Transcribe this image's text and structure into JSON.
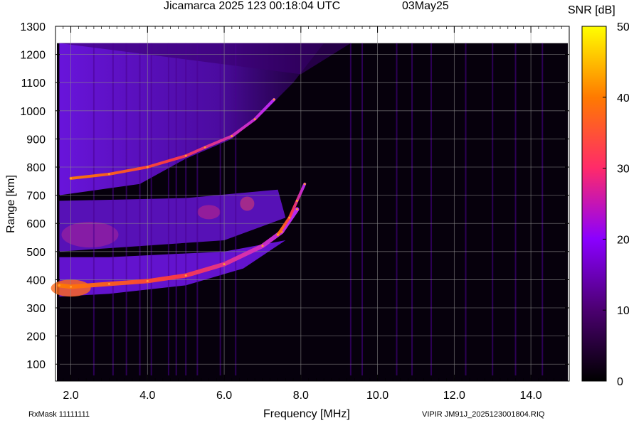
{
  "header": {
    "title": "Jicamarca 2025 123 00:18:04 UTC",
    "date": "03May25"
  },
  "colorbar": {
    "label": "SNR [dB]",
    "ticks": [
      0,
      10,
      20,
      30,
      40,
      50
    ]
  },
  "footer": {
    "rxmask": "RxMask 11111111",
    "filename": "VIPIR  JM91J_2025123001804.RIQ"
  },
  "chart_data": {
    "type": "heatmap",
    "xlabel": "Frequency [MHz]",
    "ylabel": "Range [km]",
    "xlim": [
      1.6,
      15.0
    ],
    "ylim": [
      40,
      1300
    ],
    "xticks": [
      "2.0",
      "4.0",
      "6.0",
      "8.0",
      "10.0",
      "12.0",
      "14.0"
    ],
    "yticks": [
      "100",
      "200",
      "300",
      "400",
      "500",
      "600",
      "700",
      "800",
      "900",
      "1000",
      "1100",
      "1200",
      "1300"
    ],
    "grid": true,
    "colorscale": [
      "#000000",
      "#4b0070",
      "#8a00ff",
      "#ff2a6a",
      "#ff7a00",
      "#ffff00"
    ],
    "zlim": [
      0,
      50
    ],
    "traces": [
      {
        "name": "",
        "x": [
          1.7,
          2.0,
          3.0,
          4.0,
          5.0,
          6.0,
          7.0,
          7.5,
          7.9
        ],
        "y": [
          380,
          375,
          385,
          395,
          415,
          455,
          520,
          570,
          650
        ]
      },
      {
        "name": "",
        "x": [
          2.0,
          3.0,
          4.0,
          5.0,
          5.5,
          6.2,
          6.8,
          7.3
        ],
        "y": [
          760,
          775,
          800,
          840,
          870,
          910,
          970,
          1040
        ]
      },
      {
        "name": "",
        "x": [
          7.4,
          7.7,
          7.9,
          8.1
        ],
        "y": [
          560,
          620,
          680,
          740
        ]
      }
    ]
  }
}
